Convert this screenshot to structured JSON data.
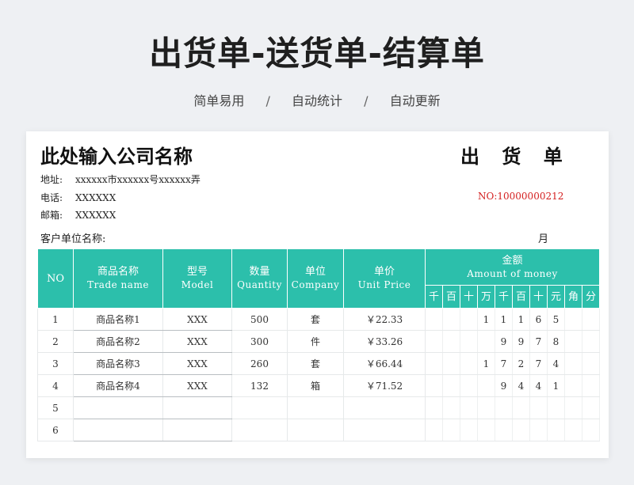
{
  "banner": {
    "title": "出货单-送货单-结算单",
    "subtitles": [
      "简单易用",
      "自动统计",
      "自动更新"
    ],
    "separator": "/"
  },
  "sheet": {
    "company_name": "此处输入公司名称",
    "doc_title": "出 货 单",
    "address_label": "地址:",
    "address_value": "xxxxxx市xxxxxx号xxxxxx弄",
    "phone_label": "电话:",
    "phone_value": "XXXXXX",
    "email_label": "邮箱:",
    "email_value": "XXXXXX",
    "doc_number": "NO:10000000212",
    "customer_label": "客户单位名称:",
    "month_label": "月"
  },
  "table": {
    "header_color": "#2cbfab",
    "headers": {
      "no": "NO",
      "name_cn": "商品名称",
      "name_en": "Trade name",
      "model_cn": "型号",
      "model_en": "Model",
      "qty_cn": "数量",
      "qty_en": "Quantity",
      "unit_cn": "单位",
      "unit_en": "Company",
      "price_cn": "单价",
      "price_en": "Unit Price",
      "amount_cn": "金额",
      "amount_en": "Amount of money",
      "digits": [
        "千",
        "百",
        "十",
        "万",
        "千",
        "百",
        "十",
        "元",
        "角",
        "分"
      ]
    },
    "rows": [
      {
        "no": "1",
        "name": "商品名称1",
        "model": "XXX",
        "qty": "500",
        "unit": "套",
        "price": "￥22.33",
        "digits": [
          "",
          "",
          "",
          "1",
          "1",
          "1",
          "6",
          "5",
          "",
          ""
        ]
      },
      {
        "no": "2",
        "name": "商品名称2",
        "model": "XXX",
        "qty": "300",
        "unit": "件",
        "price": "￥33.26",
        "digits": [
          "",
          "",
          "",
          "",
          "9",
          "9",
          "7",
          "8",
          "",
          ""
        ]
      },
      {
        "no": "3",
        "name": "商品名称3",
        "model": "XXX",
        "qty": "260",
        "unit": "套",
        "price": "￥66.44",
        "digits": [
          "",
          "",
          "",
          "1",
          "7",
          "2",
          "7",
          "4",
          "",
          ""
        ]
      },
      {
        "no": "4",
        "name": "商品名称4",
        "model": "XXX",
        "qty": "132",
        "unit": "箱",
        "price": "￥71.52",
        "digits": [
          "",
          "",
          "",
          "",
          "9",
          "4",
          "4",
          "1",
          "",
          ""
        ]
      },
      {
        "no": "5",
        "name": "",
        "model": "",
        "qty": "",
        "unit": "",
        "price": "",
        "digits": [
          "",
          "",
          "",
          "",
          "",
          "",
          "",
          "",
          "",
          ""
        ]
      },
      {
        "no": "6",
        "name": "",
        "model": "",
        "qty": "",
        "unit": "",
        "price": "",
        "digits": [
          "",
          "",
          "",
          "",
          "",
          "",
          "",
          "",
          "",
          ""
        ]
      }
    ]
  }
}
